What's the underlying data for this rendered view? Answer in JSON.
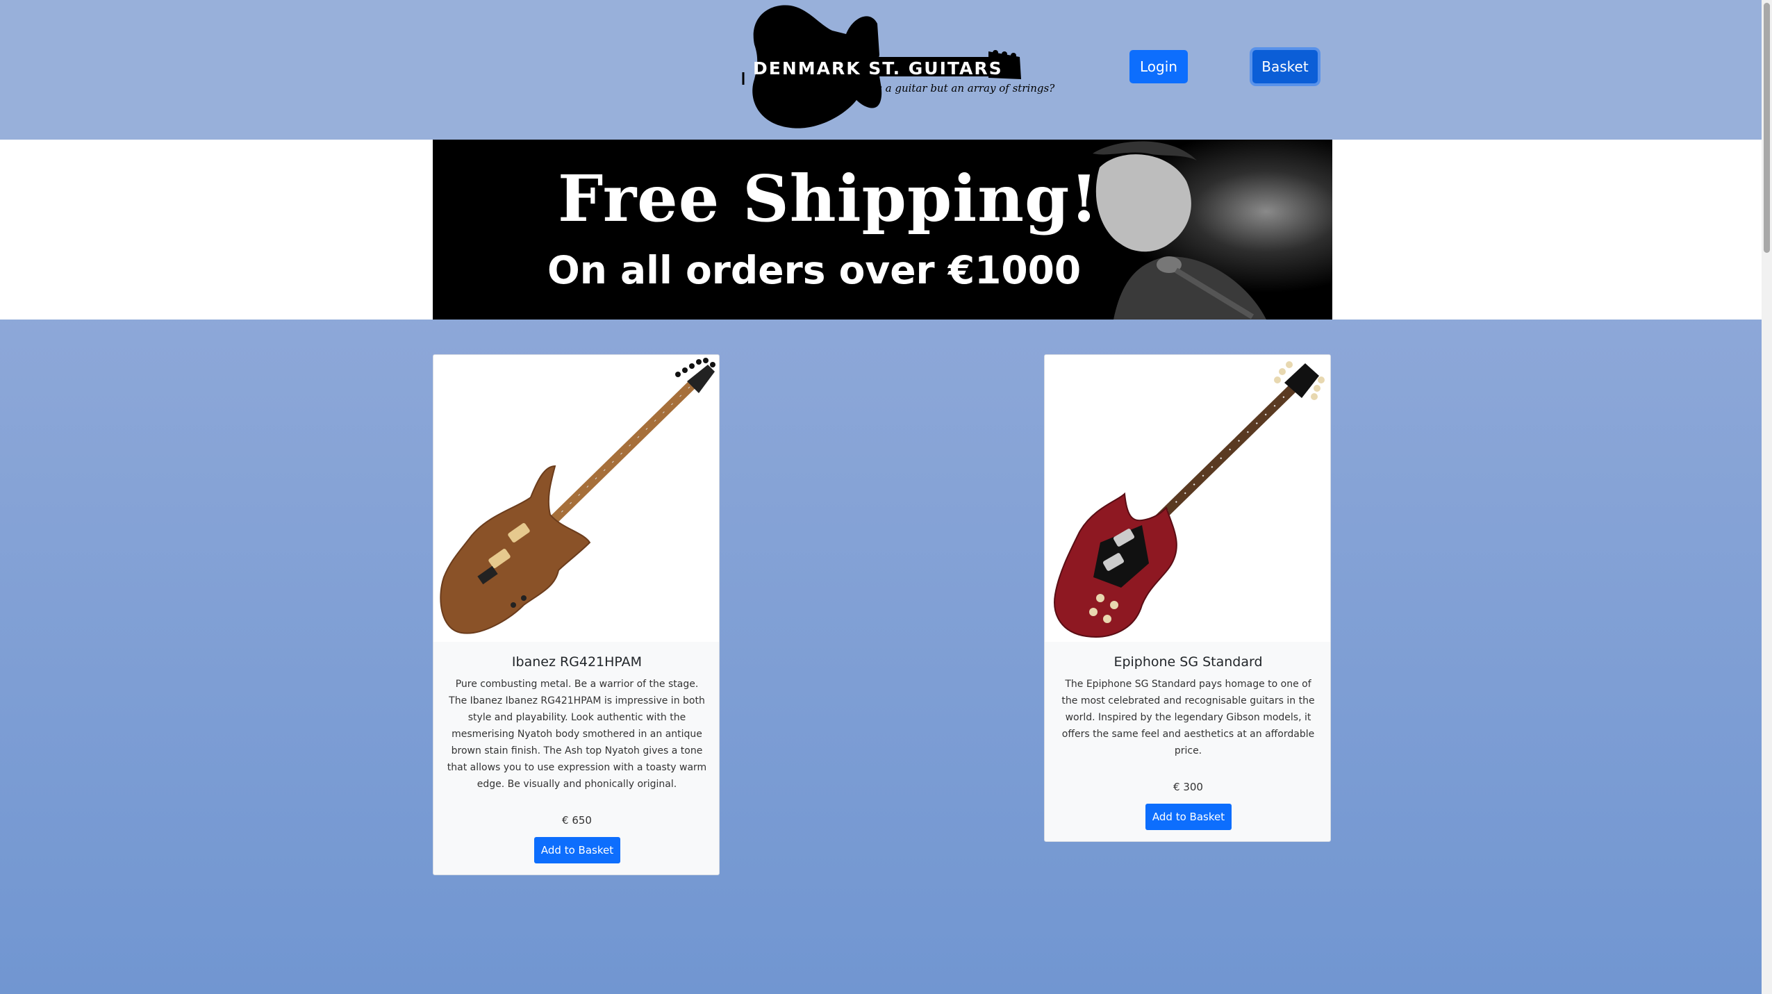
{
  "header": {
    "logo_title": "DENMARK ST. GUITARS",
    "logo_tagline": "What's a guitar but an array of strings?",
    "login_label": "Login",
    "basket_label": "Basket"
  },
  "banner": {
    "line1": "Free Shipping!",
    "line2": "On all orders over €1000"
  },
  "products": [
    {
      "name": "Ibanez RG421HPAM",
      "description": "Pure combusting metal. Be a warrior of the stage. The Ibanez Ibanez RG421HPAM is impressive in both style and playability. Look authentic with the mesmerising Nyatoh body smothered in an antique brown stain finish. The Ash top Nyatoh gives a tone that allows you to use expression with a toasty warm edge. Be visually and phonically original.",
      "price": "€ 650",
      "button": "Add to Basket",
      "image_icon": "brown-electric-guitar-icon"
    },
    {
      "name": "Epiphone SG Standard",
      "description": "The Epiphone SG Standard pays homage to one of the most celebrated and recognisable guitars in the world. Inspired by the legendary Gibson models, it offers the same feel and aesthetics at an affordable price.",
      "price": "€ 300",
      "button": "Add to Basket",
      "image_icon": "red-sg-guitar-icon"
    }
  ],
  "colors": {
    "primary": "#0d6efd",
    "header_bg": "#98b0da",
    "page_gradient_bottom": "#7196d1"
  }
}
